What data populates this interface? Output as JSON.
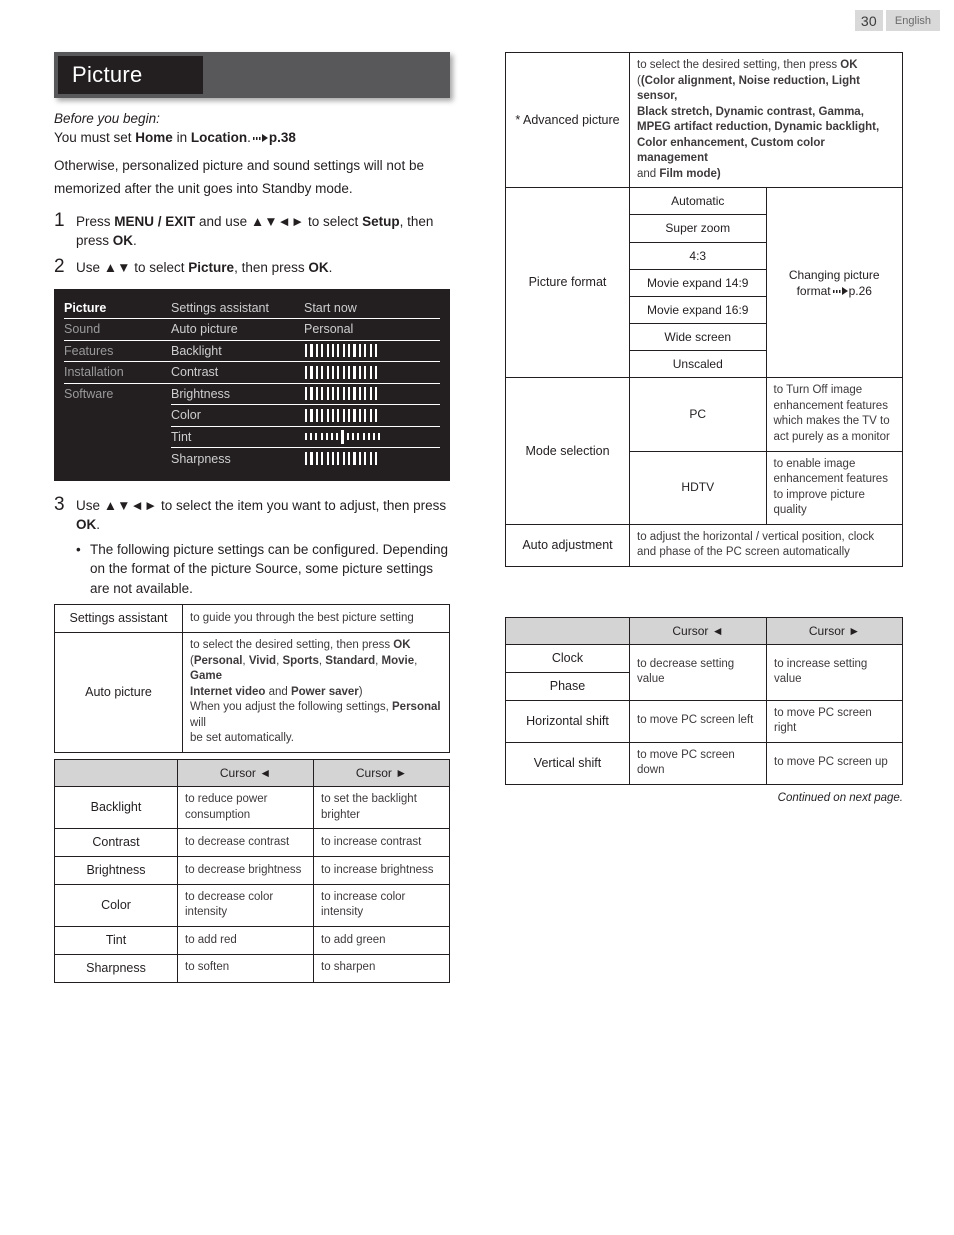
{
  "page_header": {
    "page_number": "30",
    "language": "English"
  },
  "section": {
    "title": "Picture",
    "before_you_begin_label": "Before you begin:",
    "before_line1_a": "You must set ",
    "before_line1_home": "Home",
    "before_line1_b": " in ",
    "before_line1_location": "Location",
    "before_line1_c": ".",
    "before_line1_ref": "p.38",
    "before_line2": "Otherwise, personalized picture and sound settings will not be",
    "before_line3": "memorized after the unit goes into Standby mode."
  },
  "steps": [
    {
      "number": "1",
      "text_a": "Press ",
      "bold_a": "MENU / EXIT",
      "text_b": " and use ",
      "arrows": "▲▼◄►",
      "text_c": " to select ",
      "bold_b": "Setup",
      "text_d": ", then press ",
      "bold_c": "OK",
      "text_e": "."
    },
    {
      "number": "2",
      "text_a": "Use ",
      "arrows": "▲▼",
      "text_c": " to select ",
      "bold_b": "Picture",
      "text_d": ", then press ",
      "bold_c": "OK",
      "text_e": "."
    },
    {
      "number": "3",
      "text_a": "Use ",
      "arrows": "▲▼◄►",
      "text_c": " to select the item you want to adjust, then press ",
      "bold_c": "OK",
      "text_e": ".",
      "bullet_line1": "The following picture settings can be configured. Depending on",
      "bullet_line2": "the format of the picture Source, some picture settings are not",
      "bullet_line3": "available."
    }
  ],
  "tv_menu": {
    "left_items": [
      {
        "label": "Picture",
        "state": "active"
      },
      {
        "label": "Sound",
        "state": "dim"
      },
      {
        "label": "Features",
        "state": "dim"
      },
      {
        "label": "Installation",
        "state": "dim"
      },
      {
        "label": "Software",
        "state": "dim"
      }
    ],
    "rows": [
      {
        "name": "Settings assistant",
        "value_type": "text",
        "value": "Start now"
      },
      {
        "name": "Auto picture",
        "value_type": "text",
        "value": "Personal"
      },
      {
        "name": "Backlight",
        "value_type": "bar",
        "ticks": 14,
        "style": "tall"
      },
      {
        "name": "Contrast",
        "value_type": "bar",
        "ticks": 14,
        "style": "tall"
      },
      {
        "name": "Brightness",
        "value_type": "bar",
        "ticks": 14,
        "style": "tall"
      },
      {
        "name": "Color",
        "value_type": "bar",
        "ticks": 14,
        "style": "tall"
      },
      {
        "name": "Tint",
        "value_type": "bar",
        "ticks": 15,
        "style": "small",
        "marker_index": 7
      },
      {
        "name": "Sharpness",
        "value_type": "bar",
        "ticks": 14,
        "style": "tall"
      }
    ]
  },
  "table_settings": {
    "settings_assistant": {
      "label": "Settings assistant",
      "desc": "to guide you through the best picture setting"
    },
    "auto_picture": {
      "label": "Auto picture",
      "line1_a": "to select the desired setting, then press ",
      "line1_ok": "OK",
      "line2": "(Personal, Vivid, Sports, Standard, Movie, Game",
      "line2_items": [
        "Personal",
        "Vivid",
        "Sports",
        "Standard",
        "Movie",
        "Game"
      ],
      "line3_items": [
        "Internet video",
        "Power saver"
      ],
      "line3_join": " and ",
      "line4_a": "When you adjust the following settings, ",
      "line4_bold": "Personal",
      "line4_b": " will",
      "line5": "be set automatically."
    }
  },
  "cursor_table_left": {
    "headers": [
      "",
      "Cursor ◄",
      "Cursor ►"
    ],
    "rows": [
      {
        "label": "Backlight",
        "left": "to reduce power consumption",
        "right": "to set the backlight brighter"
      },
      {
        "label": "Contrast",
        "left": "to decrease contrast",
        "right": "to increase contrast"
      },
      {
        "label": "Brightness",
        "left": "to decrease brightness",
        "right": "to increase brightness"
      },
      {
        "label": "Color",
        "left": "to decrease color intensity",
        "right": "to increase color intensity"
      },
      {
        "label": "Tint",
        "left": "to add red",
        "right": "to add green"
      },
      {
        "label": "Sharpness",
        "left": "to soften",
        "right": "to sharpen"
      }
    ]
  },
  "right_table": {
    "advanced_picture": {
      "label": "* Advanced picture",
      "line1_a": "to select the desired setting, then press ",
      "line1_ok": "OK",
      "line2": "(Color alignment, Noise reduction, Light sensor,",
      "line3": "Black stretch, Dynamic contrast, Gamma,",
      "line4": "MPEG artifact reduction, Dynamic backlight,",
      "line5": "Color enhancement, Custom color management",
      "line6_and": "and ",
      "line6_bold": "Film mode)"
    },
    "picture_format": {
      "label": "Picture format",
      "options": [
        "Automatic",
        "Super zoom",
        "4:3",
        "Movie expand 14:9",
        "Movie expand 16:9",
        "Wide screen",
        "Unscaled"
      ],
      "note_text": "Changing picture format",
      "note_ref": "p.26"
    },
    "mode_selection": {
      "label": "Mode selection",
      "modes": [
        {
          "name": "PC",
          "desc": "to Turn Off image enhancement features which makes the TV to act purely as a monitor"
        },
        {
          "name": "HDTV",
          "desc": "to enable image enhancement features to improve picture quality"
        }
      ]
    },
    "auto_adjustment": {
      "label": "Auto adjustment",
      "desc": "to adjust the horizontal / vertical position, clock and phase of the PC screen automatically"
    }
  },
  "cursor_table_right": {
    "headers": [
      "",
      "Cursor ◄",
      "Cursor ►"
    ],
    "rows": [
      {
        "label": "Clock"
      },
      {
        "label": "Phase"
      },
      {
        "label": "Horizontal shift",
        "left": "to move PC screen left",
        "right": "to move PC screen right"
      },
      {
        "label": "Vertical shift",
        "left": "to move PC screen down",
        "right": "to move PC screen up"
      }
    ],
    "merged_left": "to decrease setting value",
    "merged_right": "to increase setting value"
  },
  "footer": {
    "continued": "Continued on next page."
  }
}
